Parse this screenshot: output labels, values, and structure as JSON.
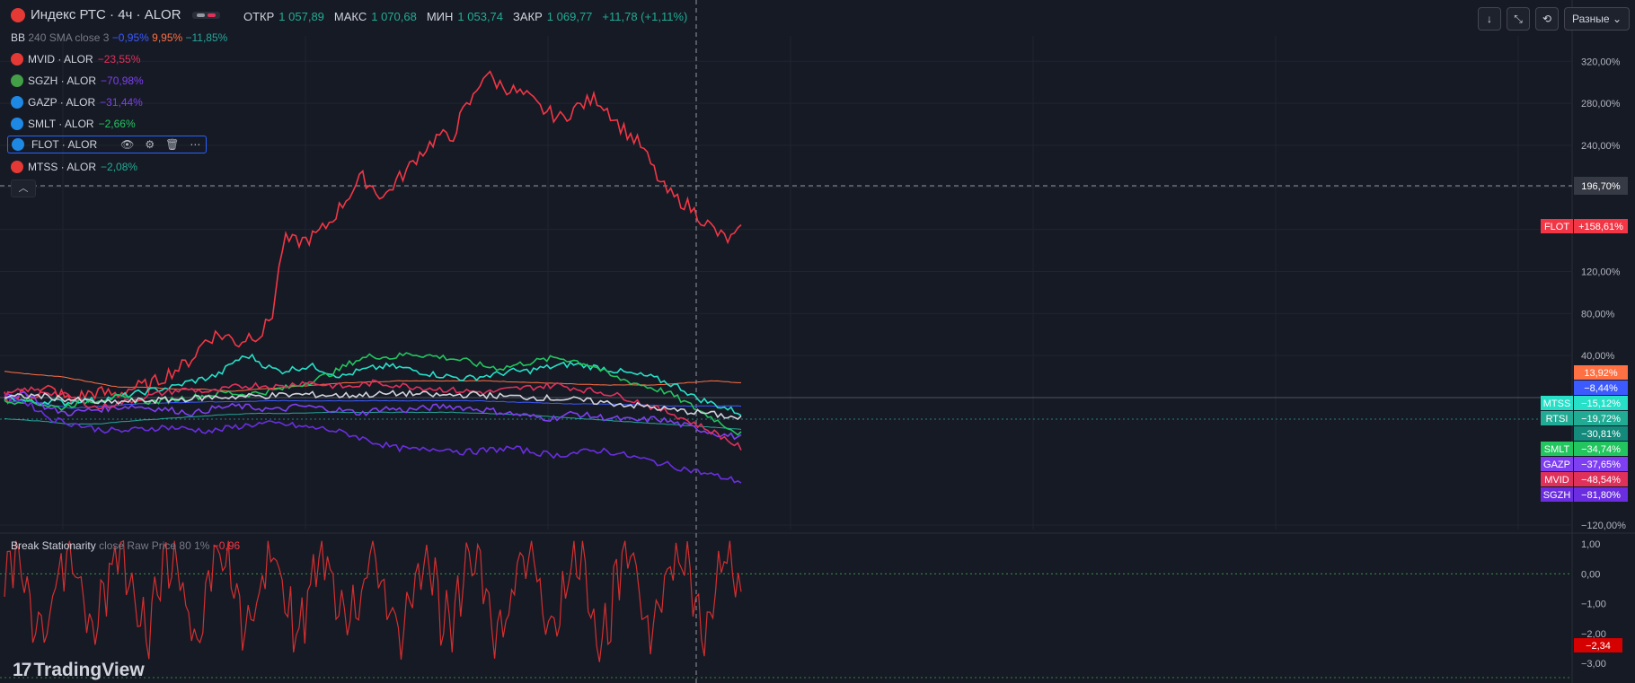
{
  "symbol": {
    "title": "Индекс РТС · 4ч · ALOR"
  },
  "ohlc": [
    {
      "label": "ОТКР",
      "value": "1 057,89"
    },
    {
      "label": "МАКС",
      "value": "1 070,68"
    },
    {
      "label": "МИН",
      "value": "1 053,74"
    },
    {
      "label": "ЗАКР",
      "value": "1 069,77"
    },
    {
      "label": "",
      "value": "+11,78 (+1,11%)"
    }
  ],
  "bb": {
    "name": "BB",
    "params": "240 SMA close 3",
    "values": [
      {
        "text": "−0,95%",
        "color": "#3d5afe"
      },
      {
        "text": "9,95%",
        "color": "#ff7043"
      },
      {
        "text": "−11,85%",
        "color": "#26a69a"
      }
    ]
  },
  "legend": [
    {
      "name": "MVID · ALOR",
      "value": "−23,55%",
      "color": "#e0315b",
      "icon": "mvid-icon",
      "iconColor": "#e53935"
    },
    {
      "name": "SGZH · ALOR",
      "value": "−70,98%",
      "color": "#7e3ff2",
      "icon": "sgzh-icon",
      "iconColor": "#43a047"
    },
    {
      "name": "GAZP · ALOR",
      "value": "−31,44%",
      "color": "#7e3ff2",
      "icon": "gazp-icon",
      "iconColor": "#1e88e5"
    },
    {
      "name": "SMLT · ALOR",
      "value": "−2,66%",
      "color": "#22c55e",
      "icon": "smlt-icon",
      "iconColor": "#1e88e5"
    },
    {
      "name": "FLOT · ALOR",
      "value": "",
      "color": "#f23645",
      "icon": "flot-icon",
      "iconColor": "#1e88e5"
    },
    {
      "name": "MTSS · ALOR",
      "value": "−2,08%",
      "color": "#22ab94",
      "icon": "mtss-icon",
      "iconColor": "#e53935"
    }
  ],
  "indicator": {
    "name": "Break Stationarity",
    "params": "close Raw Price 80 1%",
    "value": "−0,96"
  },
  "toolbar": {
    "scale_label": "Разные",
    "btn_down": "↓",
    "btn_expand": "⤡",
    "btn_fit": "⟲"
  },
  "branding": {
    "text": "TradingView",
    "mark": "17"
  },
  "chart_data": [
    {
      "type": "line",
      "yAxisTicks": [
        "320,00%",
        "280,00%",
        "240,00%",
        "200,00%",
        "160,00%",
        "120,00%",
        "80,00%",
        "40,00%",
        "0,00%",
        "−120,00%"
      ],
      "crosshair_label": "196,70%",
      "series": [
        {
          "name": "FLOT",
          "color": "#f23645",
          "last": "+158,61%",
          "values": [
            2,
            0,
            5,
            4,
            8,
            3,
            -4,
            2,
            5,
            4,
            3,
            8,
            10,
            12,
            18,
            25,
            30,
            40,
            55,
            60,
            58,
            52,
            60,
            60,
            80,
            150,
            148,
            150,
            155,
            165,
            180,
            195,
            210,
            200,
            190,
            205,
            215,
            230,
            240,
            250,
            245,
            270,
            285,
            310,
            300,
            295,
            290,
            285,
            275,
            270,
            265,
            275,
            280,
            285,
            275,
            260,
            250,
            240,
            220,
            200,
            190,
            185,
            175,
            165,
            155,
            150,
            158
          ]
        },
        {
          "name": "MTSS",
          "color": "#26e0c8",
          "last": "−15,12%",
          "values": [
            0,
            -2,
            -5,
            -3,
            -5,
            -2,
            -3,
            0,
            2,
            5,
            8,
            10,
            15,
            18,
            22,
            35,
            40,
            30,
            25,
            28,
            30,
            25,
            20,
            25,
            28,
            30,
            28,
            25,
            22,
            20,
            18,
            20,
            22,
            25,
            25,
            28,
            30,
            32,
            30,
            28,
            25,
            22,
            20,
            15,
            10,
            0,
            -5,
            -10,
            -15
          ]
        },
        {
          "name": "SMLT",
          "color": "#22c55e",
          "last": "−34,74%",
          "values": [
            -5,
            -2,
            -6,
            -10,
            -5,
            -2,
            0,
            -2,
            -4,
            -2,
            0,
            2,
            5,
            3,
            5,
            8,
            12,
            18,
            25,
            35,
            40,
            38,
            42,
            40,
            38,
            35,
            30,
            28,
            32,
            35,
            38,
            35,
            30,
            20,
            15,
            10,
            5,
            -5,
            -15,
            -25,
            -35
          ]
        },
        {
          "name": "GAZP",
          "color": "#7e3ff2",
          "last": "−37,65%",
          "values": [
            0,
            5,
            -10,
            -15,
            -12,
            -10,
            -8,
            -10,
            -12,
            -15,
            -10,
            -8,
            -10,
            -12,
            -8,
            -10,
            -12,
            -15,
            -10,
            -12,
            -10,
            -8,
            -10,
            -12,
            -15,
            -18,
            -20,
            -15,
            -18,
            -20,
            -22,
            -20,
            -25,
            -30,
            -35,
            -38
          ]
        },
        {
          "name": "MVID",
          "color": "#e0315b",
          "last": "−48,54%",
          "values": [
            2,
            8,
            5,
            0,
            -10,
            -5,
            0,
            5,
            8,
            5,
            10,
            12,
            10,
            15,
            12,
            10,
            14,
            12,
            10,
            8,
            6,
            5,
            8,
            10,
            12,
            8,
            5,
            0,
            -8,
            -15,
            -25,
            -35,
            -48
          ]
        },
        {
          "name": "SGZH",
          "color": "#6a2ee0",
          "last": "−81,80%",
          "values": [
            0,
            -5,
            -20,
            -25,
            -30,
            -32,
            -30,
            -28,
            -30,
            -32,
            -28,
            -25,
            -25,
            -28,
            -30,
            -35,
            -42,
            -48,
            -50,
            -48,
            -52,
            -50,
            -48,
            -52,
            -55,
            -52,
            -50,
            -55,
            -60,
            -65,
            -70,
            -75,
            -80
          ]
        },
        {
          "name": "RTSI",
          "color": "#d1d4dc",
          "last": "−19,72%",
          "values": [
            0,
            2,
            -2,
            -5,
            -3,
            -2,
            0,
            1,
            2,
            3,
            2,
            3,
            4,
            2,
            3,
            1,
            0,
            -2,
            -5,
            -8,
            -12,
            -15,
            -20
          ]
        }
      ],
      "bb": {
        "upper": {
          "color": "#ff7043",
          "last": "13,92%"
        },
        "basis": {
          "color": "#3d5afe",
          "last": "−8,44%"
        },
        "lower": {
          "color": "#26a69a",
          "last": "−30,81%"
        }
      }
    },
    {
      "type": "line",
      "name": "Break Stationarity",
      "yAxisTicks": [
        "1,00",
        "0,00",
        "−1,00",
        "−2,00",
        "−3,00"
      ],
      "ylim": [
        -3.5,
        1.1
      ],
      "last": "−2,34",
      "series": [
        {
          "name": "Break Stationarity",
          "color": "#d32f2f"
        }
      ]
    }
  ]
}
